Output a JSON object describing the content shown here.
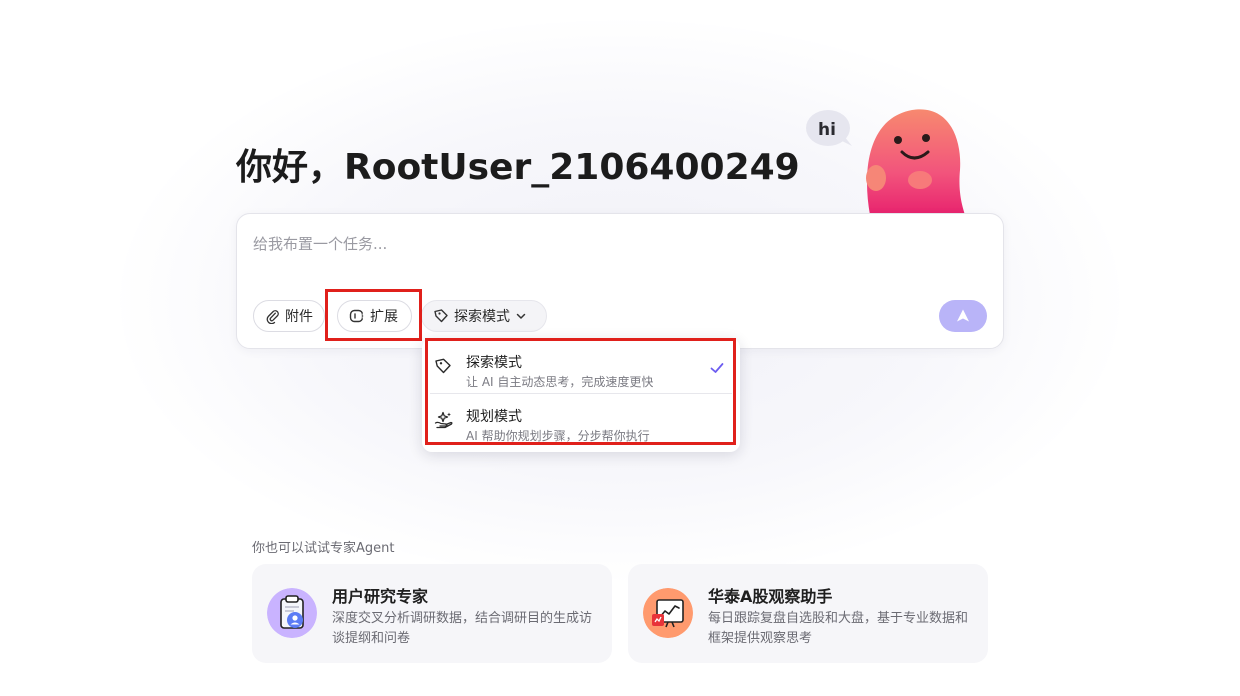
{
  "greeting": {
    "text": "你好，RootUser_2106400249"
  },
  "mascot": {
    "speech": "hi"
  },
  "composer": {
    "placeholder": "给我布置一个任务...",
    "attach_label": "附件",
    "extend_label": "扩展",
    "mode_label": "探索模式"
  },
  "mode_menu": {
    "items": [
      {
        "title": "探索模式",
        "desc": "让 AI 自主动态思考，完成速度更快",
        "selected": true,
        "icon": "tag-icon"
      },
      {
        "title": "规划模式",
        "desc": "AI 帮助你规划步骤，分步帮你执行",
        "selected": false,
        "icon": "sparkle-hand-icon"
      }
    ]
  },
  "agents": {
    "title": "你也可以试试专家Agent",
    "cards": [
      {
        "name": "用户研究专家",
        "desc": "深度交叉分析调研数据，结合调研目的生成访谈提纲和问卷",
        "icon": "clipboard-user-icon"
      },
      {
        "name": "华泰A股观察助手",
        "desc": "每日跟踪复盘自选股和大盘，基于专业数据和框架提供观察思考",
        "icon": "stock-chart-icon"
      }
    ]
  },
  "colors": {
    "accent": "#6c5cf0",
    "send_button": "#b9b4f8",
    "highlight": "#e0201b",
    "mascot_pink": "#f2607a"
  }
}
